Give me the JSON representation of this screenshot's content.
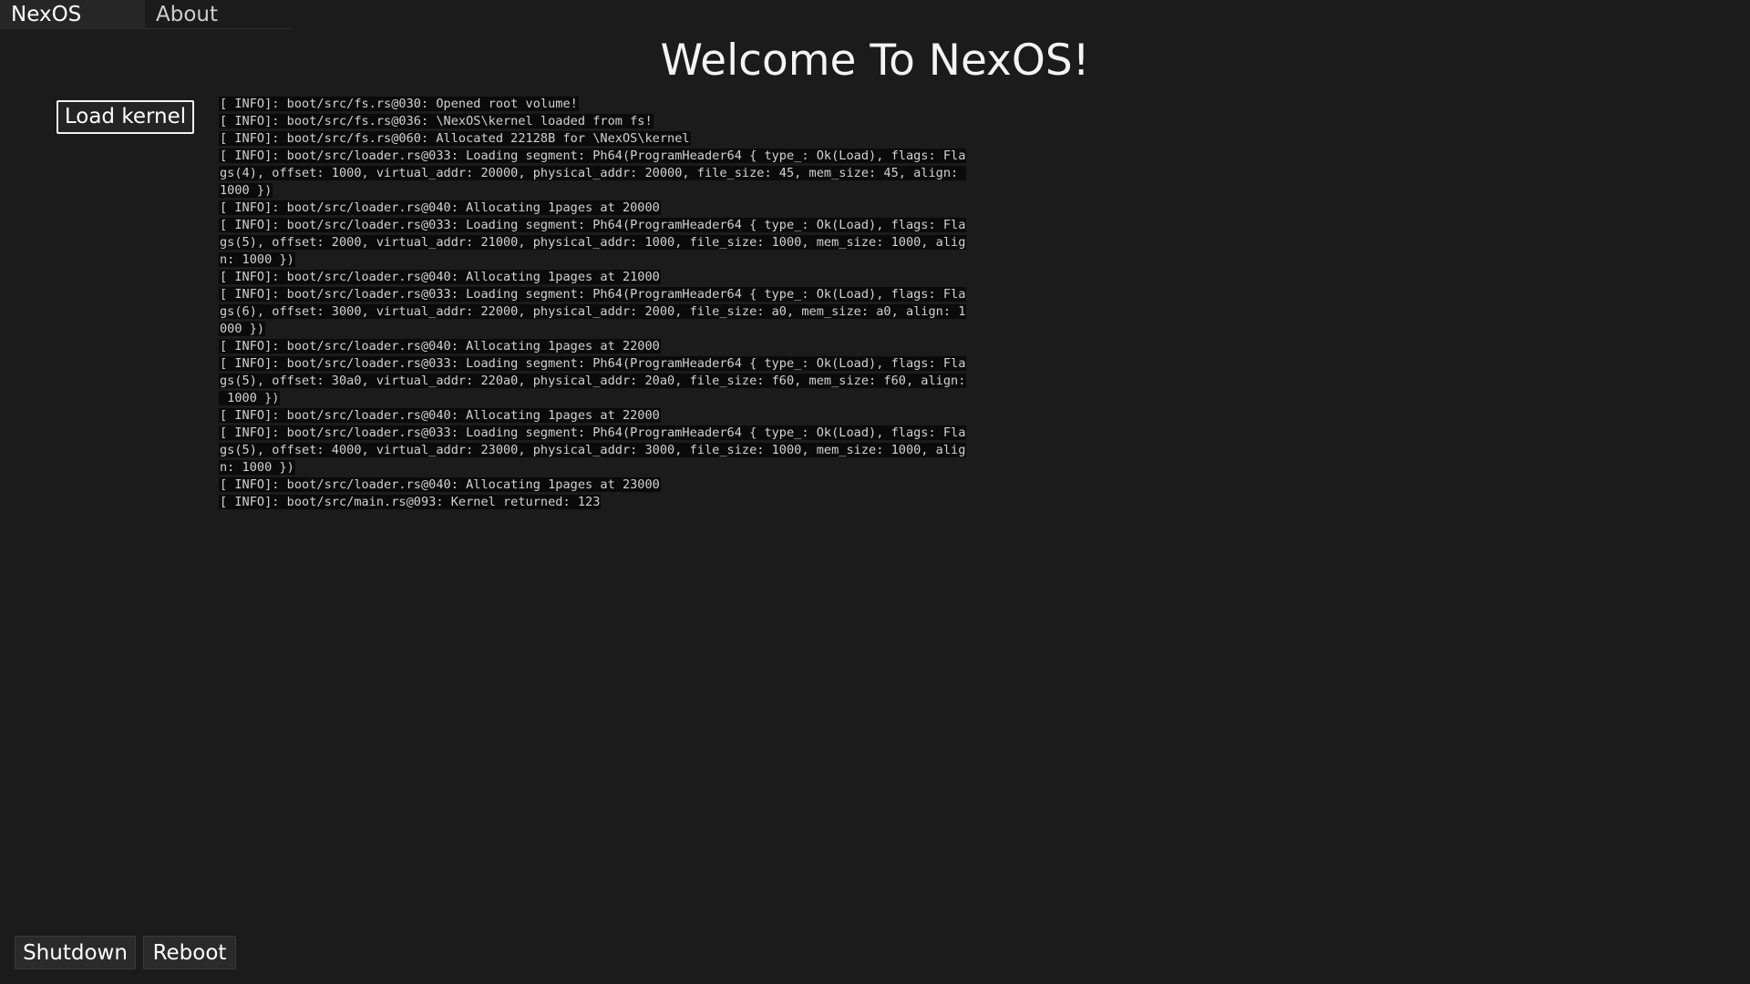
{
  "tabs": [
    {
      "label": "NexOS",
      "active": true
    },
    {
      "label": "About",
      "active": false
    }
  ],
  "title": "Welcome To NexOS!",
  "load_button": "Load kernel",
  "log_lines": [
    "[ INFO]: boot/src/fs.rs@030: Opened root volume!",
    "[ INFO]: boot/src/fs.rs@036: \\NexOS\\kernel loaded from fs!",
    "[ INFO]: boot/src/fs.rs@060: Allocated 22128B for \\NexOS\\kernel",
    "[ INFO]: boot/src/loader.rs@033: Loading segment: Ph64(ProgramHeader64 { type_: Ok(Load), flags: Fla",
    "gs(4), offset: 1000, virtual_addr: 20000, physical_addr: 20000, file_size: 45, mem_size: 45, align: ",
    "1000 })",
    "[ INFO]: boot/src/loader.rs@040: Allocating 1pages at 20000",
    "[ INFO]: boot/src/loader.rs@033: Loading segment: Ph64(ProgramHeader64 { type_: Ok(Load), flags: Fla",
    "gs(5), offset: 2000, virtual_addr: 21000, physical_addr: 1000, file_size: 1000, mem_size: 1000, alig",
    "n: 1000 })",
    "[ INFO]: boot/src/loader.rs@040: Allocating 1pages at 21000",
    "[ INFO]: boot/src/loader.rs@033: Loading segment: Ph64(ProgramHeader64 { type_: Ok(Load), flags: Fla",
    "gs(6), offset: 3000, virtual_addr: 22000, physical_addr: 2000, file_size: a0, mem_size: a0, align: 1",
    "000 })",
    "[ INFO]: boot/src/loader.rs@040: Allocating 1pages at 22000",
    "[ INFO]: boot/src/loader.rs@033: Loading segment: Ph64(ProgramHeader64 { type_: Ok(Load), flags: Fla",
    "gs(5), offset: 30a0, virtual_addr: 220a0, physical_addr: 20a0, file_size: f60, mem_size: f60, align:",
    " 1000 })",
    "[ INFO]: boot/src/loader.rs@040: Allocating 1pages at 22000",
    "[ INFO]: boot/src/loader.rs@033: Loading segment: Ph64(ProgramHeader64 { type_: Ok(Load), flags: Fla",
    "gs(5), offset: 4000, virtual_addr: 23000, physical_addr: 3000, file_size: 1000, mem_size: 1000, alig",
    "n: 1000 })",
    "[ INFO]: boot/src/loader.rs@040: Allocating 1pages at 23000",
    "[ INFO]: boot/src/main.rs@093: Kernel returned: 123"
  ],
  "footer": {
    "shutdown_label": "Shutdown",
    "reboot_label": "Reboot"
  },
  "colors": {
    "background": "#1b1b1b",
    "active_tab": "#262626",
    "log_highlight": "#0a0a0a"
  }
}
